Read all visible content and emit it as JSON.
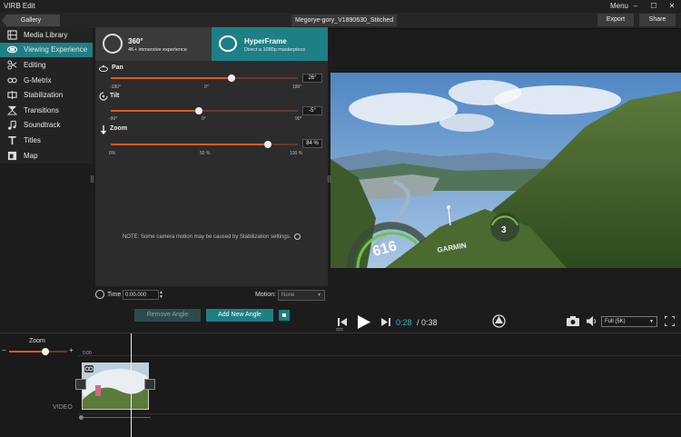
{
  "window": {
    "title": "VIRB Edit",
    "menu_label": "Menu",
    "minimize": "–",
    "maximize": "☐",
    "close": "✕"
  },
  "topbar": {
    "gallery_label": "Gallery",
    "project_name": "Megorye-gory_V1890630_Stitched",
    "export_label": "Export",
    "share_label": "Share"
  },
  "sidebar": {
    "items": [
      {
        "label": "Media Library",
        "icon": "media-library-icon"
      },
      {
        "label": "Viewing Experience",
        "icon": "viewing-experience-icon",
        "active": true
      },
      {
        "label": "Editing",
        "icon": "scissors-icon"
      },
      {
        "label": "G-Metrix",
        "icon": "g-metrix-icon"
      },
      {
        "label": "Stabilization",
        "icon": "stabilization-icon"
      },
      {
        "label": "Transitions",
        "icon": "transitions-icon"
      },
      {
        "label": "Soundtrack",
        "icon": "music-note-icon"
      },
      {
        "label": "Titles",
        "icon": "titles-icon"
      },
      {
        "label": "Map",
        "icon": "map-icon"
      }
    ]
  },
  "panel": {
    "mode_360": {
      "title": "360°",
      "subtitle": "4K+ immersive experience"
    },
    "mode_hyperframe": {
      "title": "HyperFrame",
      "subtitle": "Direct a 1080p masterpiece"
    },
    "pan": {
      "label": "Pan",
      "value": "26°",
      "fraction": 0.6444,
      "ticks": [
        "-180°",
        "0°",
        "180°"
      ]
    },
    "tilt": {
      "label": "Tilt",
      "value": "-5°",
      "fraction": 0.4722,
      "ticks": [
        "-90°",
        "0°",
        "90°"
      ]
    },
    "zoom": {
      "label": "Zoom",
      "value": "84 %",
      "fraction": 0.84,
      "ticks": [
        "0%",
        "50 %",
        "100 %"
      ]
    },
    "note": "NOTE: Some camera motion may be caused by Stabilization settings."
  },
  "time_row": {
    "label": "Time",
    "value": "0:00.000",
    "motion_label": "Motion:",
    "motion_value": "None"
  },
  "angle_row": {
    "remove_label": "Remove Angle",
    "add_label": "Add New Angle"
  },
  "preview": {
    "speed_value": "616",
    "brand": "GARMIN",
    "small_gauge_value": "3"
  },
  "player": {
    "current_time": "0:28",
    "separator": " / ",
    "total_time": "0:38",
    "quality": "Full (5K)"
  },
  "timeline": {
    "zoom_label": "Zoom",
    "zoom_fraction": 0.625,
    "start_time": "0:00",
    "track_label": "VIDEO"
  },
  "colors": {
    "accent": "#1e7f86",
    "slider": "#e05a1e",
    "time_accent": "#2fb5be"
  }
}
